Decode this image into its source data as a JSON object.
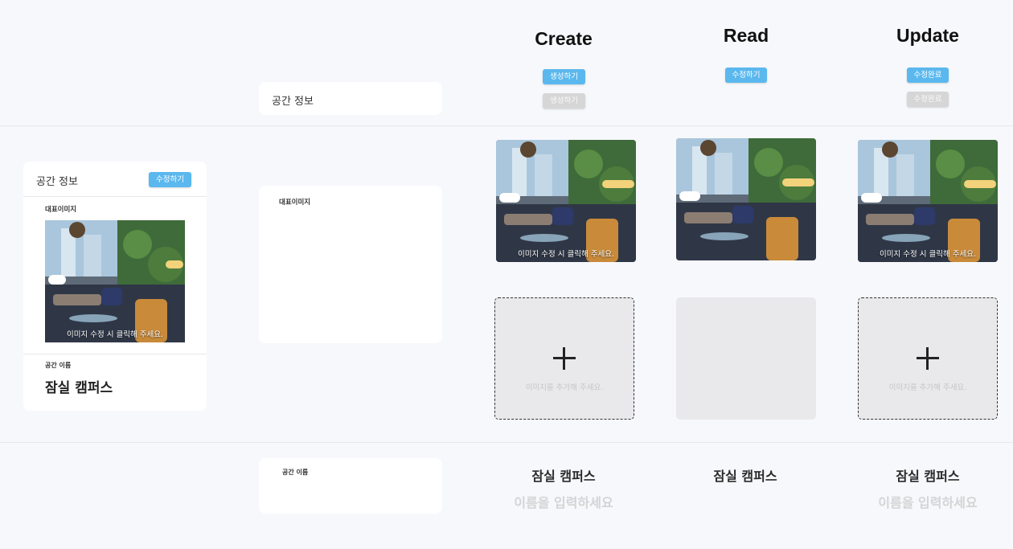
{
  "columns": {
    "create": "Create",
    "read": "Read",
    "update": "Update"
  },
  "buttons": {
    "create_primary": "생성하기",
    "create_disabled": "생성하기",
    "read_edit": "수정하기",
    "update_primary": "수정완료",
    "update_disabled": "수정완료"
  },
  "section_labels": {
    "space_info": "공간 정보",
    "main_image": "대표이미지",
    "space_name": "공간 이름"
  },
  "preview_card": {
    "title": "공간 정보",
    "edit_button": "수정하기",
    "image_label": "대표이미지",
    "image_caption": "이미지 수정 시 클릭해 주세요.",
    "name_label": "공간 이름",
    "name_value": "잠실 캠퍼스"
  },
  "image_captions": {
    "create": "이미지 수정 시 클릭해 주세요.",
    "update": "이미지 수정 시 클릭해 주세요."
  },
  "add_image_hint": {
    "create": "이미지를 추가해 주세요.",
    "update": "이미지를 추가해 주세요."
  },
  "name_values": {
    "create": "잠실 캠퍼스",
    "read": "잠실 캠퍼스",
    "update": "잠실 캠퍼스"
  },
  "name_placeholder": {
    "create": "이름을 입력하세요",
    "update": "이름을 입력하세요"
  },
  "colors": {
    "accent": "#5ab8ee",
    "disabled": "#d6d6d6",
    "background": "#f7f8fc"
  }
}
